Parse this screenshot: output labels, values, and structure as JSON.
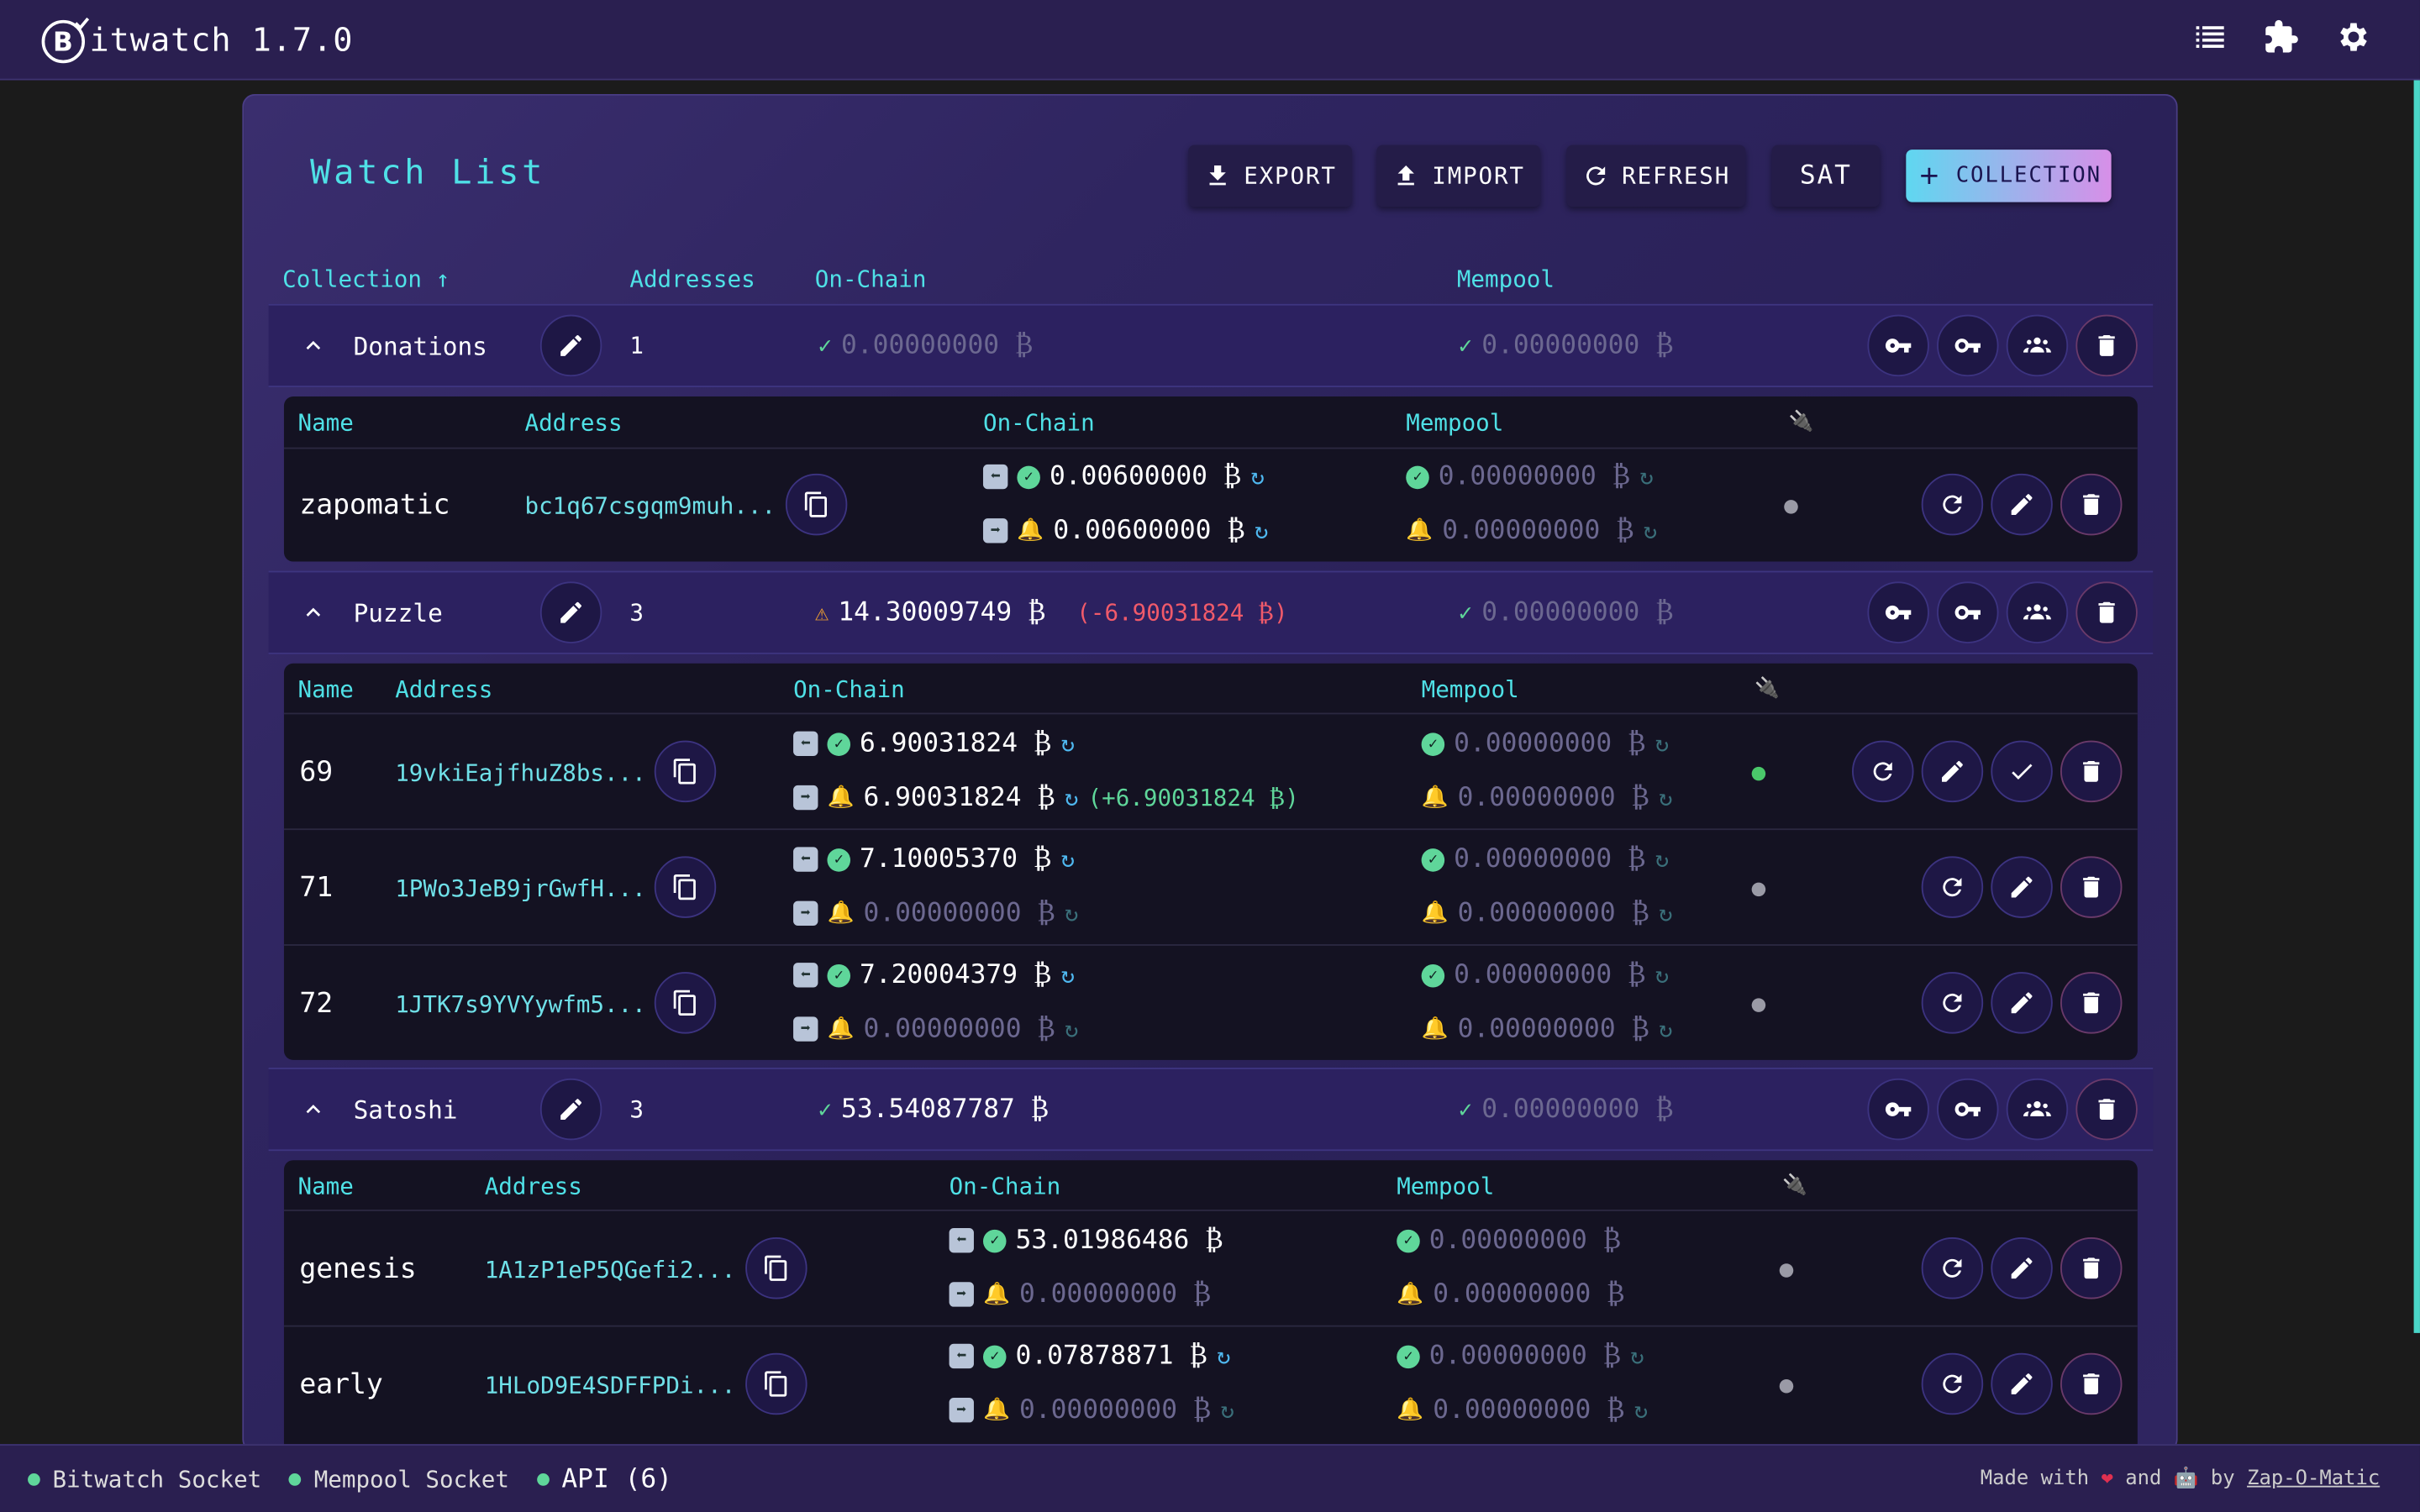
{
  "app": {
    "title": "itwatch 1.7.0"
  },
  "header": {
    "title": "Watch List",
    "export": "EXPORT",
    "import": "IMPORT",
    "refresh": "REFRESH",
    "unit": "SAT",
    "collection": "COLLECTION"
  },
  "columns": {
    "collection": "Collection ↑",
    "addresses": "Addresses",
    "onchain": "On-Chain",
    "mempool": "Mempool"
  },
  "sub_columns": {
    "name": "Name",
    "address": "Address",
    "onchain": "On-Chain",
    "mempool": "Mempool"
  },
  "groups": [
    {
      "name": "Donations",
      "count": "1",
      "onchain": "0.00000000 ₿",
      "onchain_status": "ok",
      "mempool": "0.00000000 ₿"
    },
    {
      "name": "Puzzle",
      "count": "3",
      "onchain": "14.30009749 ₿",
      "onchain_diff": "(-6.90031824 ₿)",
      "onchain_status": "warn",
      "mempool": "0.00000000 ₿"
    },
    {
      "name": "Satoshi",
      "count": "3",
      "onchain": "53.54087787 ₿",
      "onchain_status": "ok",
      "mempool": "0.00000000 ₿"
    }
  ],
  "rows": {
    "zapomatic": {
      "name": "zapomatic",
      "address": "bc1q67csgqm9muh...",
      "in": "0.00600000 ₿",
      "out": "0.00600000 ₿",
      "mp_in": "0.00000000 ₿",
      "mp_out": "0.00000000 ₿"
    },
    "r69": {
      "name": "69",
      "address": "19vkiEajfhuZ8bs...",
      "in": "6.90031824 ₿",
      "out": "6.90031824 ₿",
      "out_diff": "(+6.90031824 ₿)",
      "mp_in": "0.00000000 ₿",
      "mp_out": "0.00000000 ₿"
    },
    "r71": {
      "name": "71",
      "address": "1PWo3JeB9jrGwfH...",
      "in": "7.10005370 ₿",
      "out": "0.00000000 ₿",
      "mp_in": "0.00000000 ₿",
      "mp_out": "0.00000000 ₿"
    },
    "r72": {
      "name": "72",
      "address": "1JTK7s9YVYywfm5...",
      "in": "7.20004379 ₿",
      "out": "0.00000000 ₿",
      "mp_in": "0.00000000 ₿",
      "mp_out": "0.00000000 ₿"
    },
    "genesis": {
      "name": "genesis",
      "address": "1A1zP1eP5QGefi2...",
      "in": "53.01986486 ₿",
      "out": "0.00000000 ₿",
      "mp_in": "0.00000000 ₿",
      "mp_out": "0.00000000 ₿"
    },
    "early": {
      "name": "early",
      "address": "1HLoD9E4SDFFPDi...",
      "in": "0.07878871 ₿",
      "out": "0.00000000 ₿",
      "mp_in": "0.00000000 ₿",
      "mp_out": "0.00000000 ₿"
    }
  },
  "footer": {
    "bitwatch": "Bitwatch Socket",
    "mempool": "Mempool Socket",
    "api": "API (6)",
    "made": "Made with",
    "and": "and",
    "by": "by",
    "author": "Zap-O-Matic"
  },
  "colors": {
    "accent": "#4fe0e6",
    "ok": "#5fd69a",
    "warn": "#f0a030",
    "negative": "#f05a6a",
    "positive": "#5fd69a"
  }
}
